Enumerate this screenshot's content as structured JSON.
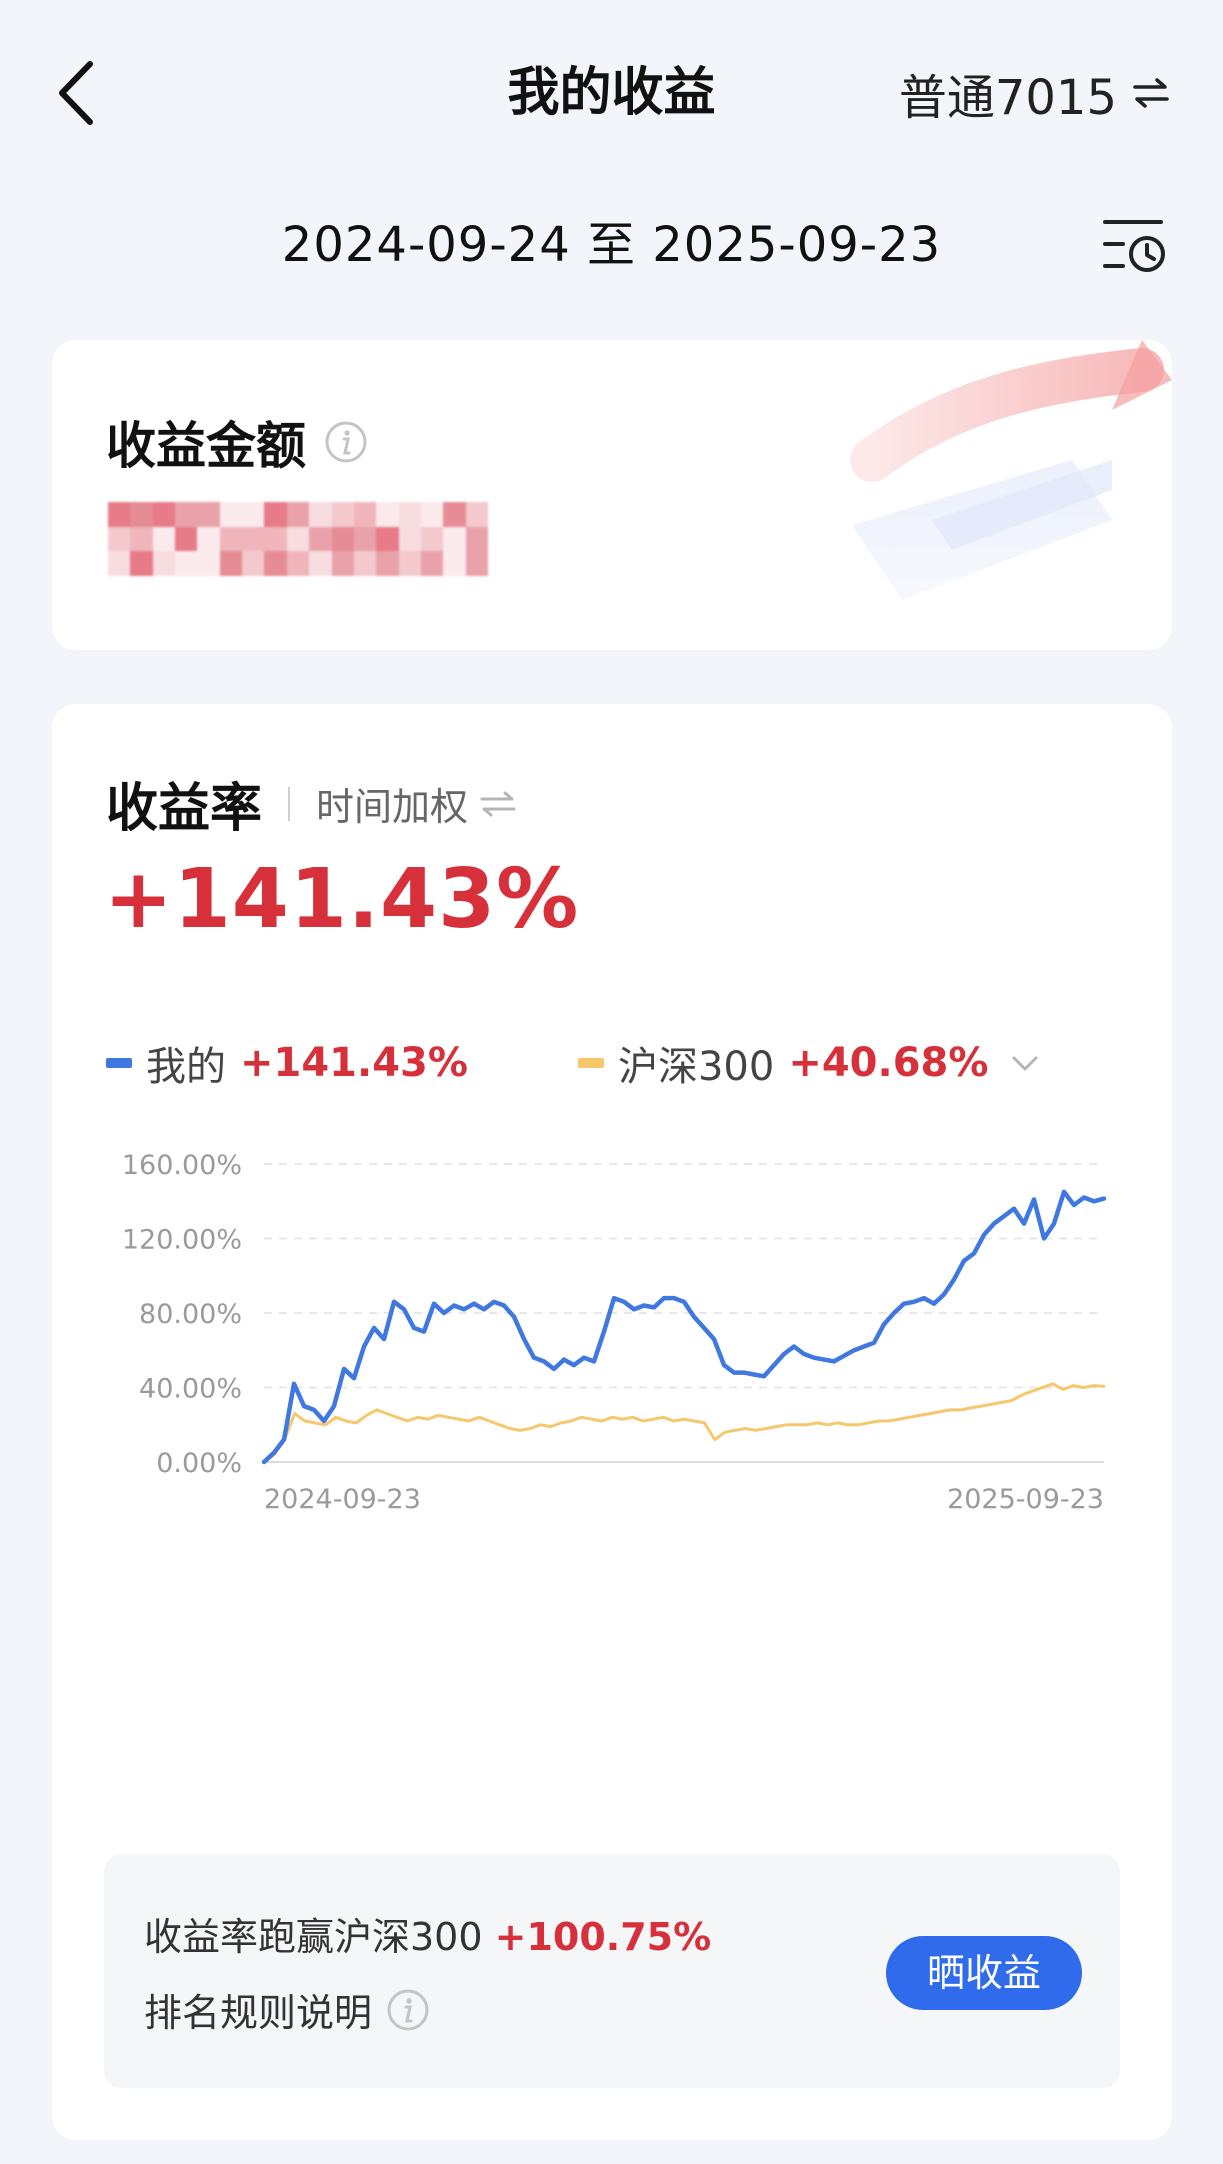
{
  "header": {
    "title": "我的收益",
    "account": "普通7015",
    "date_range": "2024-09-24 至 2025-09-23"
  },
  "amount_card": {
    "label": "收益金额"
  },
  "rate_card": {
    "label": "收益率",
    "mode": "时间加权",
    "value": "+141.43%"
  },
  "legend": {
    "mine_name": "我的",
    "mine_value": "+141.43%",
    "bench_name": "沪深300",
    "bench_value": "+40.68%"
  },
  "compare": {
    "prefix": "收益率跑赢沪深300 ",
    "value": "+100.75%",
    "rule_text": "排名规则说明",
    "share_button": "晒收益"
  },
  "colors": {
    "mine": "#3f78e0",
    "bench": "#f6c76b",
    "positive": "#d6303a",
    "accent": "#2f6bea"
  },
  "chart_data": {
    "type": "line",
    "x_start": "2024-09-23",
    "x_end": "2025-09-23",
    "x_tick_labels": [
      "2024-09-23",
      "2025-09-23"
    ],
    "y_tick_labels": [
      "160.00%",
      "120.00%",
      "80.00%",
      "40.00%",
      "0.00%"
    ],
    "ylim": [
      0,
      160
    ],
    "grid": true,
    "series": [
      {
        "name": "我的",
        "color": "#3f78e0",
        "values": [
          0,
          5,
          12,
          42,
          30,
          28,
          22,
          30,
          50,
          45,
          62,
          72,
          66,
          86,
          82,
          72,
          70,
          85,
          80,
          84,
          82,
          85,
          82,
          86,
          84,
          78,
          66,
          56,
          54,
          50,
          55,
          52,
          56,
          54,
          70,
          88,
          86,
          82,
          84,
          83,
          88,
          88,
          86,
          78,
          72,
          66,
          52,
          48,
          48,
          47,
          46,
          52,
          58,
          62,
          58,
          56,
          55,
          54,
          57,
          60,
          62,
          64,
          74,
          80,
          85,
          86,
          88,
          85,
          90,
          98,
          108,
          112,
          122,
          128,
          132,
          136,
          128,
          141,
          120,
          128,
          145,
          138,
          142,
          140,
          141.43
        ]
      },
      {
        "name": "沪深300",
        "color": "#f6c76b",
        "values": [
          0,
          4,
          12,
          26,
          22,
          21,
          20,
          24,
          22,
          21,
          25,
          28,
          26,
          24,
          22,
          24,
          23,
          25,
          24,
          23,
          22,
          24,
          22,
          20,
          18,
          17,
          18,
          20,
          19,
          21,
          22,
          24,
          23,
          22,
          24,
          23,
          24,
          22,
          23,
          24,
          22,
          23,
          22,
          21,
          12,
          16,
          17,
          18,
          17,
          18,
          19,
          20,
          20,
          20,
          21,
          20,
          21,
          20,
          20,
          21,
          22,
          22,
          23,
          24,
          25,
          26,
          27,
          28,
          28,
          29,
          30,
          31,
          32,
          33,
          36,
          38,
          40,
          42,
          39,
          41,
          40,
          41,
          40.68
        ]
      }
    ]
  }
}
